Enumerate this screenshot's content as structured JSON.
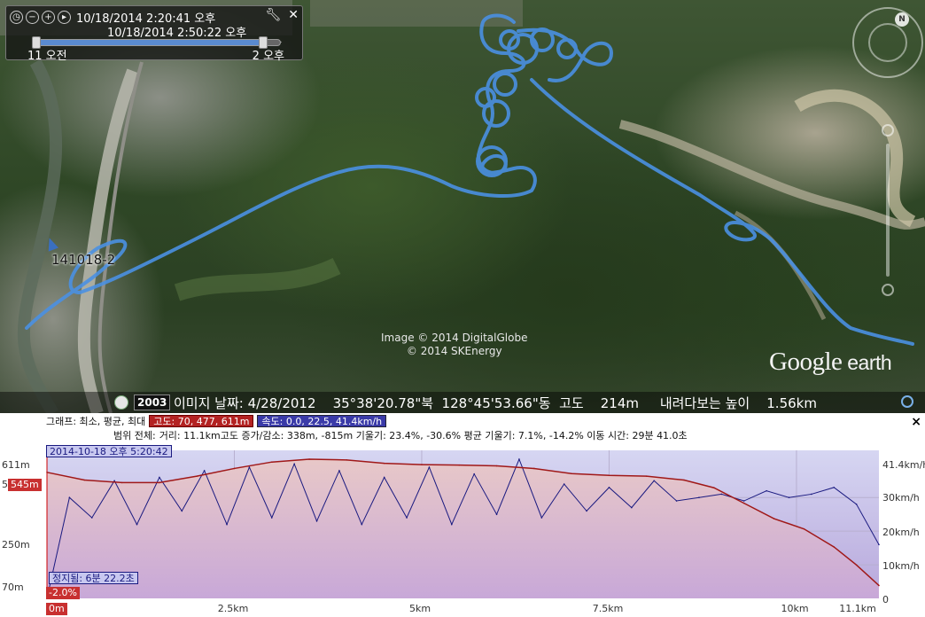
{
  "time_slider": {
    "start": "10/18/2014    2:20:41 오후",
    "end": "10/18/2014    2:50:22 오후",
    "left_label": "11 오전",
    "right_label": "2 오후",
    "range_start_fraction": 0.0,
    "range_end_fraction": 0.95
  },
  "map": {
    "track_label": "141018-2",
    "credit_line1": "Image © 2014 DigitalGlobe",
    "credit_line2": "© 2014 SKEnergy",
    "logo_google": "Google",
    "logo_earth": " earth",
    "track_color": "#4a90e2",
    "compass_north": "N"
  },
  "status_bar": {
    "year": "2003",
    "text": "이미지 날짜: 4/28/2012    35°38'20.78\"북  128°45'53.66\"동  고도    214m     내려다보는 높이    1.56km"
  },
  "profile": {
    "row1_label": "그래프: 최소, 평균, 최대",
    "row1_altitude": "고도: 70, 477, 611m",
    "row1_speed": "속도: 0.0, 22.5, 41.4km/h",
    "row2_label": "범위 전체:",
    "row2_text": "거리: 11.1km고도 증가/감소: 338m, -815m  기울기: 23.4%, -30.6%  평균 기울기: 7.1%, -14.2% 이동 시간: 29분 41.0초",
    "close": "×",
    "cursor_time": "2014-10-18 오후 5:20:42",
    "stop_time": "정지됨: 6분 22.2초",
    "cursor_slope": "-2.0%",
    "cursor_alt": "545m",
    "cursor_dist": "0m",
    "y_left": [
      "611m",
      "5",
      "250m",
      "70m"
    ],
    "y_right": [
      "41.4km/h",
      "30km/h",
      "20km/h",
      "10km/h",
      "0"
    ],
    "x_ticks": [
      "2.5km",
      "5km",
      "7.5km",
      "10km",
      "11.1km"
    ]
  },
  "chart_data": {
    "type": "line",
    "title": "",
    "xlabel": "",
    "ylabel": "",
    "x_unit": "km",
    "xlim": [
      0,
      11.1
    ],
    "series": [
      {
        "name": "고도",
        "unit": "m",
        "color": "#a01818",
        "ylim": [
          70,
          611
        ],
        "x": [
          0,
          0.5,
          1.0,
          1.5,
          2.0,
          2.5,
          3.0,
          3.5,
          4.0,
          4.5,
          5.0,
          5.5,
          6.0,
          6.5,
          7.0,
          7.5,
          8.0,
          8.5,
          8.9,
          9.3,
          9.7,
          10.1,
          10.5,
          10.8,
          11.1
        ],
        "values": [
          560,
          530,
          520,
          520,
          545,
          575,
          600,
          611,
          608,
          595,
          590,
          588,
          585,
          575,
          555,
          548,
          545,
          530,
          500,
          440,
          380,
          340,
          270,
          200,
          120
        ]
      },
      {
        "name": "속도",
        "unit": "km/h",
        "color": "#1a1a80",
        "ylim": [
          0,
          41.4
        ],
        "x": [
          0,
          0.3,
          0.6,
          0.9,
          1.2,
          1.5,
          1.8,
          2.1,
          2.4,
          2.7,
          3.0,
          3.3,
          3.6,
          3.9,
          4.2,
          4.5,
          4.8,
          5.1,
          5.4,
          5.7,
          6.0,
          6.3,
          6.6,
          6.9,
          7.2,
          7.5,
          7.8,
          8.1,
          8.4,
          8.7,
          9.0,
          9.3,
          9.6,
          9.9,
          10.2,
          10.5,
          10.8,
          11.1
        ],
        "values": [
          0,
          30,
          24,
          35,
          22,
          36,
          26,
          38,
          22,
          39,
          24,
          40,
          23,
          38,
          22,
          36,
          24,
          39,
          22,
          37,
          25,
          41.4,
          24,
          34,
          26,
          33,
          27,
          35,
          29,
          30,
          31,
          29,
          32,
          30,
          31,
          33,
          28,
          16
        ]
      }
    ],
    "grid": true,
    "legend": "top-left"
  }
}
